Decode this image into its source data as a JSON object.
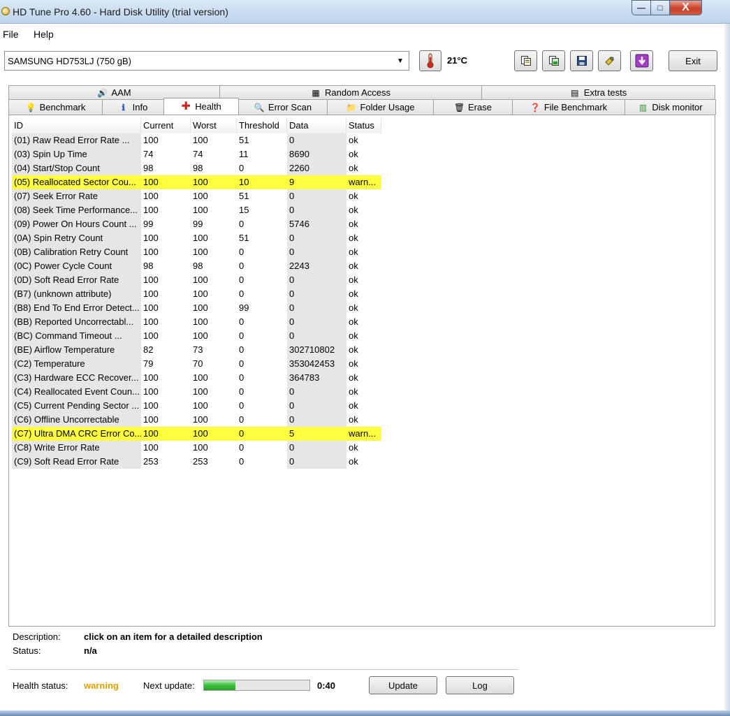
{
  "window": {
    "title": "HD Tune Pro 4.60 - Hard Disk Utility (trial version)",
    "minimize_glyph": "—",
    "maximize_glyph": "□",
    "close_glyph": "X"
  },
  "menu": {
    "file": "File",
    "help": "Help"
  },
  "toolbar": {
    "drive": "SAMSUNG HD753LJ (750 gB)",
    "dropdown_glyph": "▼",
    "temperature": "21°C",
    "exit_label": "Exit"
  },
  "tabs_row1": [
    {
      "label": "AAM",
      "icon": "speaker-icon",
      "glyph": "🔊"
    },
    {
      "label": "Random Access",
      "icon": "random-access-icon",
      "glyph": "▦"
    },
    {
      "label": "Extra tests",
      "icon": "extra-tests-icon",
      "glyph": "▤"
    }
  ],
  "tabs_row2": [
    {
      "label": "Benchmark",
      "icon": "lightbulb-icon",
      "glyph": "💡"
    },
    {
      "label": "Info",
      "icon": "info-icon",
      "glyph": "ℹ"
    },
    {
      "label": "Health",
      "icon": "health-cross-icon",
      "glyph": "✚",
      "active": true
    },
    {
      "label": "Error Scan",
      "icon": "magnifier-icon",
      "glyph": "🔍"
    },
    {
      "label": "Folder Usage",
      "icon": "folder-icon",
      "glyph": "📁"
    },
    {
      "label": "Erase",
      "icon": "trash-icon",
      "glyph": "🗑"
    },
    {
      "label": "File Benchmark",
      "icon": "file-benchmark-icon",
      "glyph": "❓"
    },
    {
      "label": "Disk monitor",
      "icon": "disk-monitor-icon",
      "glyph": "▥"
    }
  ],
  "table": {
    "headers": [
      "ID",
      "Current",
      "Worst",
      "Threshold",
      "Data",
      "Status"
    ],
    "rows": [
      [
        "(01) Raw Read Error Rate      ...",
        "100",
        "100",
        "51",
        "0",
        "ok"
      ],
      [
        "(03) Spin Up Time",
        "74",
        "74",
        "11",
        "8690",
        "ok"
      ],
      [
        "(04) Start/Stop Count",
        "98",
        "98",
        "0",
        "2260",
        "ok"
      ],
      [
        "(05) Reallocated Sector Cou...",
        "100",
        "100",
        "10",
        "9",
        "warn..."
      ],
      [
        "(07) Seek Error Rate",
        "100",
        "100",
        "51",
        "0",
        "ok"
      ],
      [
        "(08) Seek Time Performance...",
        "100",
        "100",
        "15",
        "0",
        "ok"
      ],
      [
        "(09) Power On Hours Count   ...",
        "99",
        "99",
        "0",
        "5746",
        "ok"
      ],
      [
        "(0A) Spin Retry Count",
        "100",
        "100",
        "51",
        "0",
        "ok"
      ],
      [
        "(0B) Calibration Retry Count",
        "100",
        "100",
        "0",
        "0",
        "ok"
      ],
      [
        "(0C) Power Cycle Count",
        "98",
        "98",
        "0",
        "2243",
        "ok"
      ],
      [
        "(0D) Soft Read Error Rate",
        "100",
        "100",
        "0",
        "0",
        "ok"
      ],
      [
        "(B7) (unknown attribute)",
        "100",
        "100",
        "0",
        "0",
        "ok"
      ],
      [
        "(B8) End To End Error Detect...",
        "100",
        "100",
        "99",
        "0",
        "ok"
      ],
      [
        "(BB) Reported Uncorrectabl...",
        "100",
        "100",
        "0",
        "0",
        "ok"
      ],
      [
        "(BC) Command Timeout       ...",
        "100",
        "100",
        "0",
        "0",
        "ok"
      ],
      [
        "(BE) Airflow Temperature",
        "82",
        "73",
        "0",
        "302710802",
        "ok"
      ],
      [
        "(C2) Temperature",
        "79",
        "70",
        "0",
        "353042453",
        "ok"
      ],
      [
        "(C3) Hardware ECC Recover...",
        "100",
        "100",
        "0",
        "364783",
        "ok"
      ],
      [
        "(C4) Reallocated Event Coun...",
        "100",
        "100",
        "0",
        "0",
        "ok"
      ],
      [
        "(C5) Current Pending Sector  ...",
        "100",
        "100",
        "0",
        "0",
        "ok"
      ],
      [
        "(C6) Offline Uncorrectable",
        "100",
        "100",
        "0",
        "0",
        "ok"
      ],
      [
        "(C7) Ultra DMA CRC Error Co...",
        "100",
        "100",
        "0",
        "5",
        "warn..."
      ],
      [
        "(C8) Write Error Rate",
        "100",
        "100",
        "0",
        "0",
        "ok"
      ],
      [
        "(C9) Soft Read Error Rate",
        "253",
        "253",
        "0",
        "0",
        "ok"
      ]
    ]
  },
  "details": {
    "description_label": "Description:",
    "description_value": "click on an item for a detailed description",
    "status_label": "Status:",
    "status_value": "n/a"
  },
  "footer": {
    "health_label": "Health status:",
    "health_value": "warning",
    "next_update_label": "Next update:",
    "progress_fraction": 0.3,
    "countdown": "0:40",
    "update_label": "Update",
    "log_label": "Log"
  },
  "colors": {
    "warn_row": "#ffff40",
    "health_warning": "#e0a000",
    "progress": "#3cbf3c"
  }
}
